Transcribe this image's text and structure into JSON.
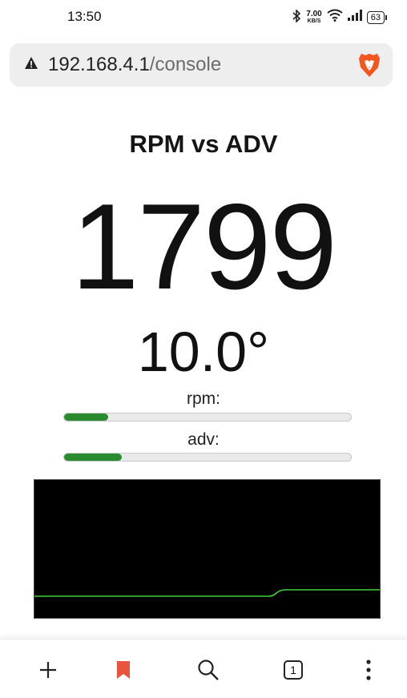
{
  "status_bar": {
    "time": "13:50",
    "net_speed_value": "7.00",
    "net_speed_unit": "KB/S",
    "battery": "63"
  },
  "browser": {
    "url_host": "192.168.4.1",
    "url_path": "/console",
    "tab_count": "1"
  },
  "page": {
    "title": "RPM vs ADV",
    "rpm_value": "1799",
    "adv_value": "10.0°",
    "rpm_label": "rpm:",
    "adv_label": "adv:",
    "rpm_fill_fraction": 0.155,
    "adv_fill_fraction": 0.2
  },
  "colors": {
    "bar_fill": "#2a8a2e",
    "plot_background": "#000000",
    "plot_line": "#3ccf3c",
    "bookmark_accent": "#e8553e"
  },
  "icons": {
    "status": [
      "bluetooth-icon",
      "wifi-icon",
      "signal-icon",
      "battery-icon"
    ],
    "browser": [
      "warning-icon",
      "brave-lion-icon"
    ],
    "nav": [
      "plus-icon",
      "bookmark-icon",
      "search-icon",
      "tabs-icon",
      "more-icon"
    ]
  }
}
